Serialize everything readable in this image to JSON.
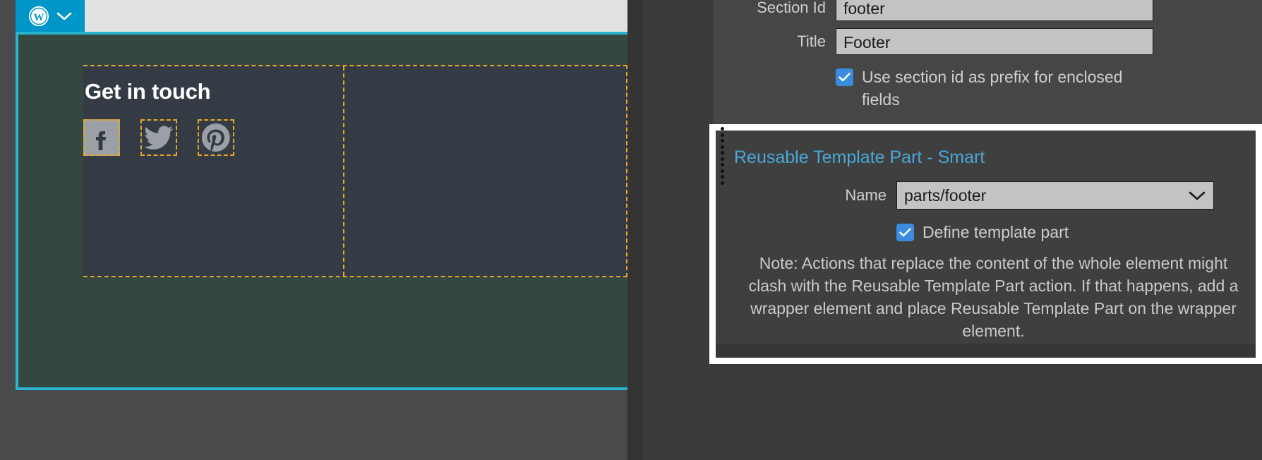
{
  "preview": {
    "adminbar": {
      "wp_logo_icon": "wordpress-logo-icon",
      "chevron_icon": "chevron-down-icon"
    },
    "footer": {
      "heading": "Get in touch",
      "social": [
        {
          "name": "facebook-icon",
          "label": "Facebook"
        },
        {
          "name": "twitter-icon",
          "label": "Twitter"
        },
        {
          "name": "pinterest-icon",
          "label": "Pinterest"
        }
      ]
    },
    "colors": {
      "selection_border": "#28b4d2",
      "section_background": "#35473f",
      "footer_background": "#343b45",
      "element_outline": "#e3a92b",
      "adminbar_background": "#e2e2e2",
      "adminbar_logo_background": "#0096c7"
    }
  },
  "properties": {
    "section": {
      "section_id_label": "Section Id",
      "section_id_value": "footer",
      "title_label": "Title",
      "title_value": "Footer",
      "prefix_checkbox_label": "Use section id as prefix for enclosed fields",
      "prefix_checkbox_checked": "checked"
    },
    "reusable_template_part": {
      "title": "Reusable Template Part - Smart",
      "name_label": "Name",
      "name_value": "parts/footer",
      "name_options": [
        "parts/footer"
      ],
      "define_checkbox_label": "Define template part",
      "define_checkbox_checked": "checked",
      "note": "Note: Actions that replace the content of the whole element might clash with the Reusable Template Part action. If that happens, add a wrapper element and place Reusable Template Part on the wrapper element.",
      "accent_color": "#4ba7d8",
      "highlight_border_color": "#ffffff"
    },
    "icons": {
      "dropdown_caret": "chevron-down-icon",
      "checkmark": "check-icon",
      "drag_handle": "drag-handle-dots-icon"
    }
  }
}
